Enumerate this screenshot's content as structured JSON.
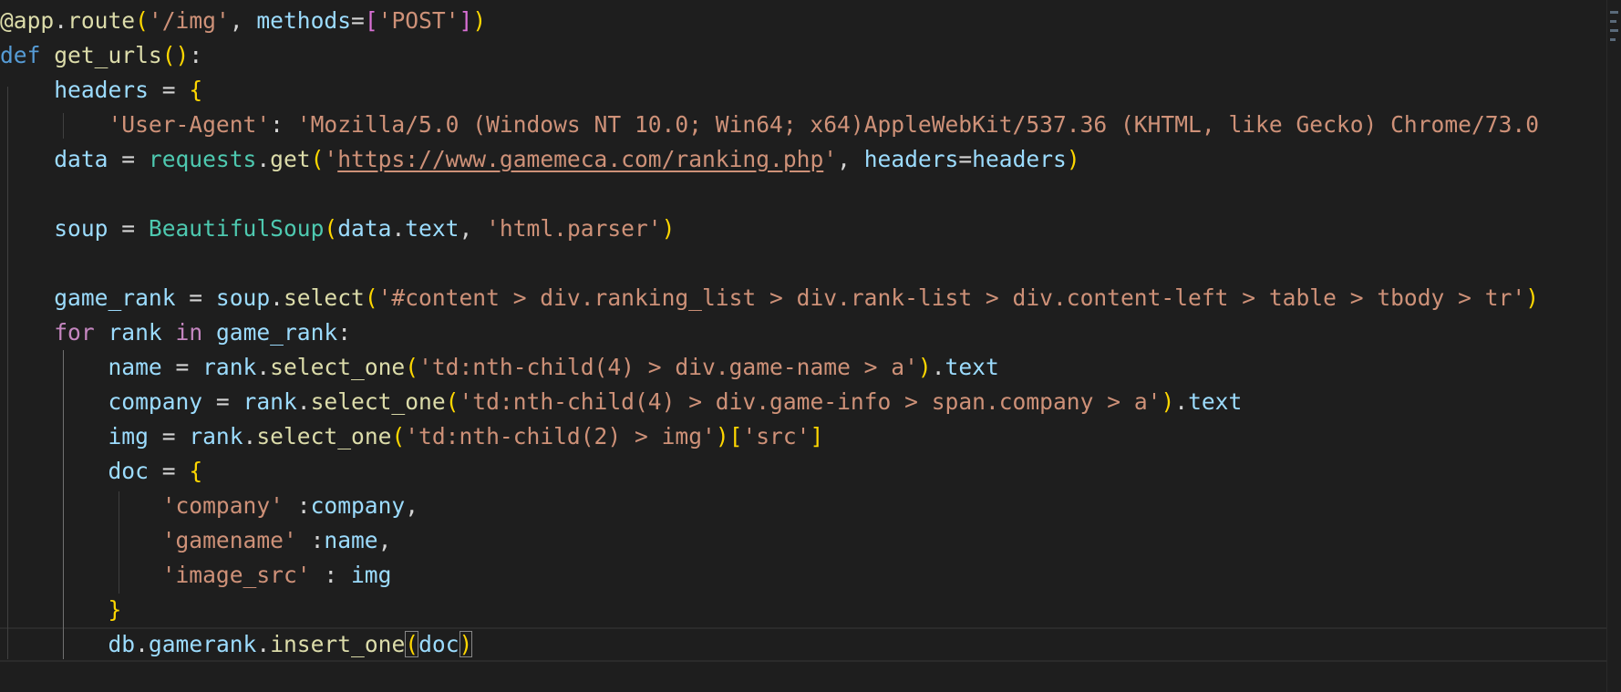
{
  "editor": {
    "language": "python",
    "lines": [
      [
        [
          "fn",
          "@app"
        ],
        [
          "pun",
          "."
        ],
        [
          "fn",
          "route"
        ],
        [
          "b1",
          "("
        ],
        [
          "str",
          "'/img'"
        ],
        [
          "pun",
          ", "
        ],
        [
          "vr",
          "methods"
        ],
        [
          "pun",
          "="
        ],
        [
          "b2",
          "["
        ],
        [
          "str",
          "'POST'"
        ],
        [
          "b2",
          "]"
        ],
        [
          "b1",
          ")"
        ]
      ],
      [
        [
          "kw",
          "def"
        ],
        [
          "pun",
          " "
        ],
        [
          "fn",
          "get_urls"
        ],
        [
          "b1",
          "()"
        ],
        [
          "pun",
          ":"
        ]
      ],
      [
        [
          "pun",
          "    "
        ],
        [
          "vr",
          "headers"
        ],
        [
          "pun",
          " = "
        ],
        [
          "b1",
          "{"
        ]
      ],
      [
        [
          "pun",
          "        "
        ],
        [
          "str",
          "'User-Agent'"
        ],
        [
          "pun",
          ": "
        ],
        [
          "str",
          "'Mozilla/5.0 (Windows NT 10.0; Win64; x64)AppleWebKit/537.36 (KHTML, like Gecko) Chrome/73.0"
        ]
      ],
      [
        [
          "pun",
          "    "
        ],
        [
          "vr",
          "data"
        ],
        [
          "pun",
          " = "
        ],
        [
          "cls",
          "requests"
        ],
        [
          "pun",
          "."
        ],
        [
          "fn",
          "get"
        ],
        [
          "b1",
          "("
        ],
        [
          "str",
          "'"
        ],
        [
          "lnk",
          "https://www.gamemeca.com/ranking.php"
        ],
        [
          "str",
          "'"
        ],
        [
          "pun",
          ", "
        ],
        [
          "vr",
          "headers"
        ],
        [
          "pun",
          "="
        ],
        [
          "vr",
          "headers"
        ],
        [
          "b1",
          ")"
        ]
      ],
      [],
      [
        [
          "pun",
          "    "
        ],
        [
          "vr",
          "soup"
        ],
        [
          "pun",
          " = "
        ],
        [
          "cls",
          "BeautifulSoup"
        ],
        [
          "b1",
          "("
        ],
        [
          "vr",
          "data"
        ],
        [
          "pun",
          "."
        ],
        [
          "vr",
          "text"
        ],
        [
          "pun",
          ", "
        ],
        [
          "str",
          "'html.parser'"
        ],
        [
          "b1",
          ")"
        ]
      ],
      [],
      [
        [
          "pun",
          "    "
        ],
        [
          "vr",
          "game_rank"
        ],
        [
          "pun",
          " = "
        ],
        [
          "vr",
          "soup"
        ],
        [
          "pun",
          "."
        ],
        [
          "fn",
          "select"
        ],
        [
          "b1",
          "("
        ],
        [
          "str",
          "'#content > div.ranking_list > div.rank-list > div.content-left > table > tbody > tr'"
        ],
        [
          "b1",
          ")"
        ]
      ],
      [
        [
          "pun",
          "    "
        ],
        [
          "ctl",
          "for"
        ],
        [
          "pun",
          " "
        ],
        [
          "vr",
          "rank"
        ],
        [
          "pun",
          " "
        ],
        [
          "ctl",
          "in"
        ],
        [
          "pun",
          " "
        ],
        [
          "vr",
          "game_rank"
        ],
        [
          "pun",
          ":"
        ]
      ],
      [
        [
          "pun",
          "        "
        ],
        [
          "vr",
          "name"
        ],
        [
          "pun",
          " = "
        ],
        [
          "vr",
          "rank"
        ],
        [
          "pun",
          "."
        ],
        [
          "fn",
          "select_one"
        ],
        [
          "b1",
          "("
        ],
        [
          "str",
          "'td:nth-child(4) > div.game-name > a'"
        ],
        [
          "b1",
          ")"
        ],
        [
          "pun",
          "."
        ],
        [
          "vr",
          "text"
        ]
      ],
      [
        [
          "pun",
          "        "
        ],
        [
          "vr",
          "company"
        ],
        [
          "pun",
          " = "
        ],
        [
          "vr",
          "rank"
        ],
        [
          "pun",
          "."
        ],
        [
          "fn",
          "select_one"
        ],
        [
          "b1",
          "("
        ],
        [
          "str",
          "'td:nth-child(4) > div.game-info > span.company > a'"
        ],
        [
          "b1",
          ")"
        ],
        [
          "pun",
          "."
        ],
        [
          "vr",
          "text"
        ]
      ],
      [
        [
          "pun",
          "        "
        ],
        [
          "vr",
          "img"
        ],
        [
          "pun",
          " = "
        ],
        [
          "vr",
          "rank"
        ],
        [
          "pun",
          "."
        ],
        [
          "fn",
          "select_one"
        ],
        [
          "b1",
          "("
        ],
        [
          "str",
          "'td:nth-child(2) > img'"
        ],
        [
          "b1",
          ")"
        ],
        [
          "b1",
          "["
        ],
        [
          "str",
          "'src'"
        ],
        [
          "b1",
          "]"
        ]
      ],
      [
        [
          "pun",
          "        "
        ],
        [
          "vr",
          "doc"
        ],
        [
          "pun",
          " = "
        ],
        [
          "b1",
          "{"
        ]
      ],
      [
        [
          "pun",
          "            "
        ],
        [
          "str",
          "'company'"
        ],
        [
          "pun",
          " :"
        ],
        [
          "vr",
          "company"
        ],
        [
          "pun",
          ","
        ]
      ],
      [
        [
          "pun",
          "            "
        ],
        [
          "str",
          "'gamename'"
        ],
        [
          "pun",
          " :"
        ],
        [
          "vr",
          "name"
        ],
        [
          "pun",
          ","
        ]
      ],
      [
        [
          "pun",
          "            "
        ],
        [
          "str",
          "'image_src'"
        ],
        [
          "pun",
          " : "
        ],
        [
          "vr",
          "img"
        ]
      ],
      [
        [
          "pun",
          "        "
        ],
        [
          "b1",
          "}"
        ]
      ],
      [
        [
          "pun",
          "        "
        ],
        [
          "vr",
          "db"
        ],
        [
          "pun",
          "."
        ],
        [
          "vr",
          "gamerank"
        ],
        [
          "pun",
          "."
        ],
        [
          "fn",
          "insert_one"
        ],
        [
          "b1bm",
          "("
        ],
        [
          "vr",
          "doc"
        ],
        [
          "b1bm",
          ")"
        ]
      ]
    ]
  }
}
